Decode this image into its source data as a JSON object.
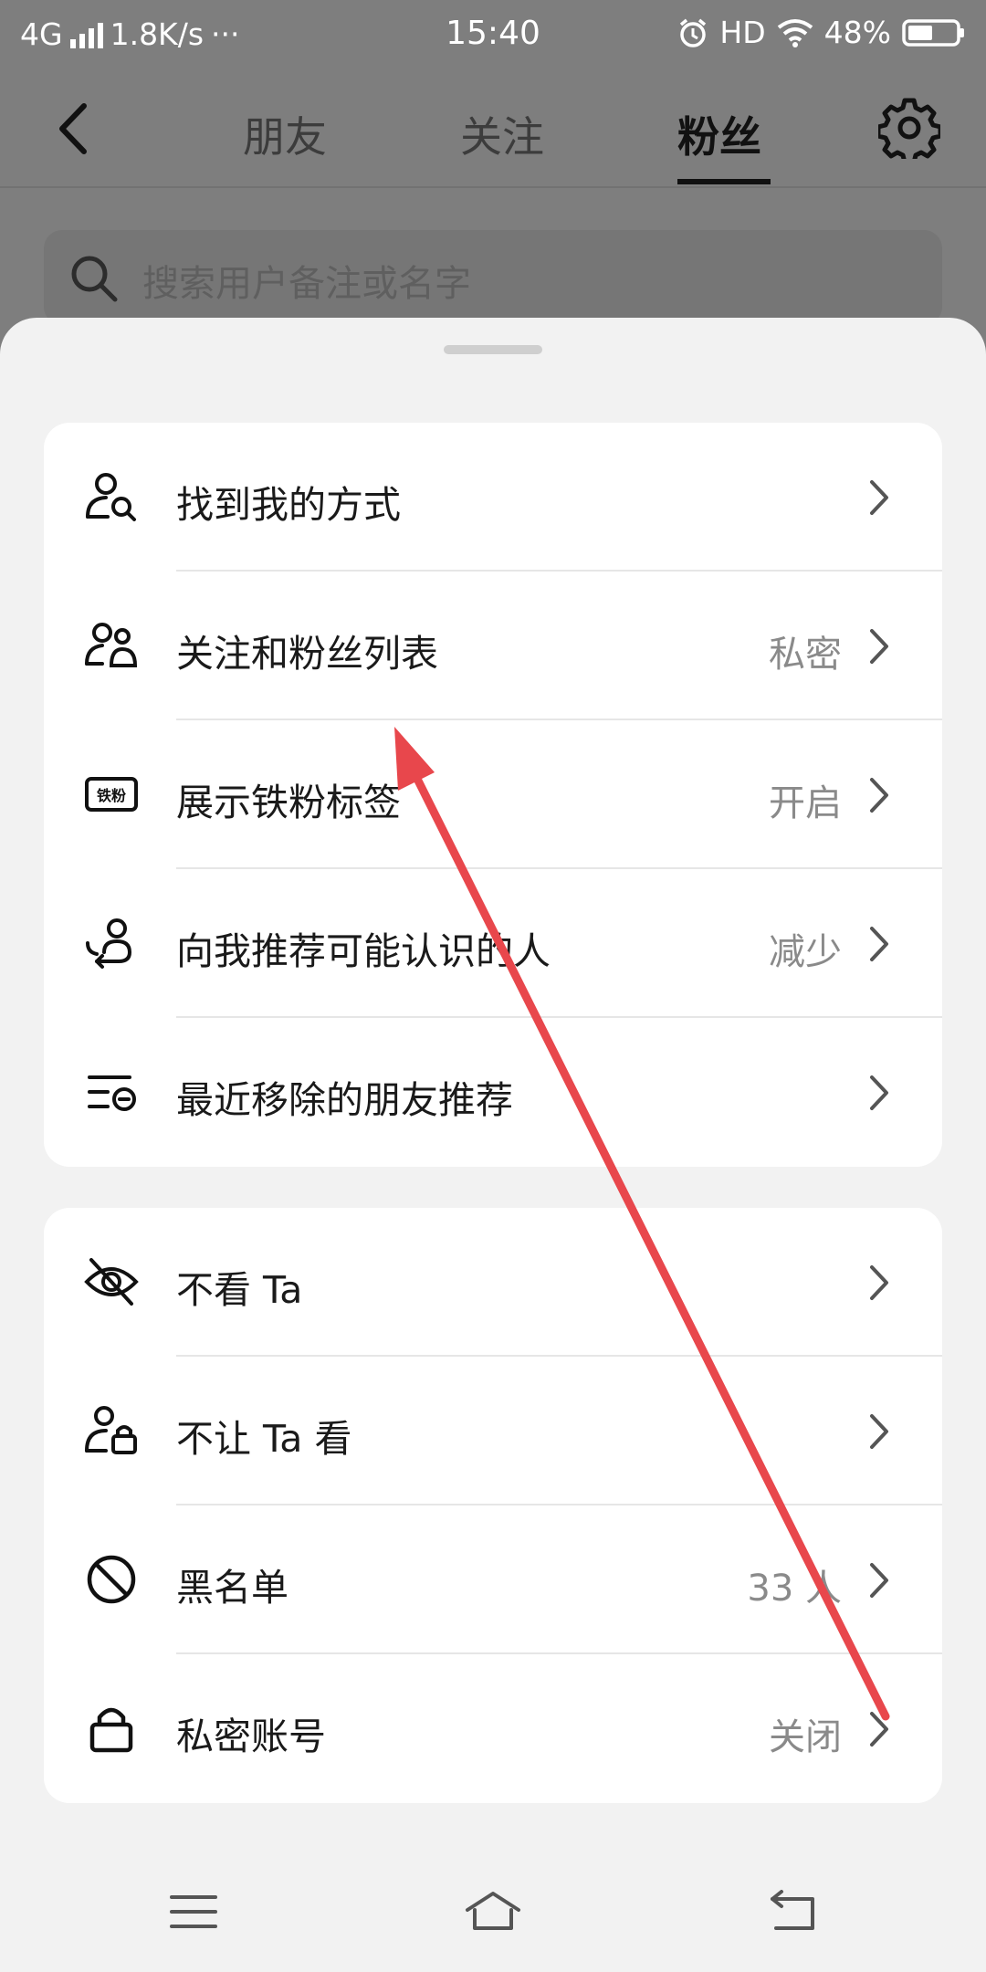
{
  "status_bar": {
    "network": "4G",
    "speed": "1.8K/s",
    "dots": "···",
    "time": "15:40",
    "hd": "HD",
    "battery": "48%"
  },
  "nav": {
    "tabs": [
      {
        "label": "朋友"
      },
      {
        "label": "关注"
      },
      {
        "label": "粉丝"
      }
    ],
    "active_tab": "粉丝"
  },
  "search": {
    "placeholder": "搜索用户备注或名字"
  },
  "group1": [
    {
      "label": "找到我的方式",
      "value": "",
      "icon": "user-search-icon"
    },
    {
      "label": "关注和粉丝列表",
      "value": "私密",
      "icon": "users-icon"
    },
    {
      "label": "展示铁粉标签",
      "value": "开启",
      "icon": "iron-fan-badge-icon",
      "badge_text": "铁粉"
    },
    {
      "label": "向我推荐可能认识的人",
      "value": "减少",
      "icon": "recommend-person-icon"
    },
    {
      "label": "最近移除的朋友推荐",
      "value": "",
      "icon": "removed-list-icon"
    }
  ],
  "group2": [
    {
      "label": "不看 Ta",
      "value": "",
      "icon": "eye-off-icon"
    },
    {
      "label": "不让 Ta 看",
      "value": "",
      "icon": "user-lock-icon"
    },
    {
      "label": "黑名单",
      "value": "33 人",
      "icon": "block-icon"
    },
    {
      "label": "私密账号",
      "value": "关闭",
      "icon": "lock-icon"
    }
  ],
  "colors": {
    "annotation_arrow": "#e8474c"
  }
}
